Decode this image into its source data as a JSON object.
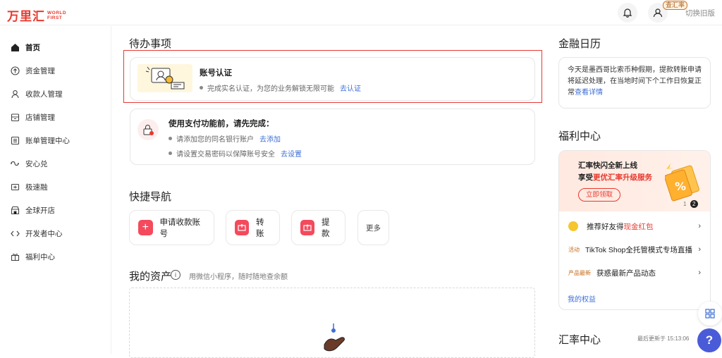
{
  "header": {
    "logo_cn": "万里汇",
    "logo_en_1": "WORLD",
    "logo_en_2": "FIRST",
    "rate_badge": "查汇率",
    "switch_old": "切换旧版"
  },
  "sidebar": {
    "items": [
      {
        "label": "首页",
        "icon": "home-icon",
        "active": true
      },
      {
        "label": "资金管理",
        "icon": "funds-icon"
      },
      {
        "label": "收款人管理",
        "icon": "payee-icon"
      },
      {
        "label": "店铺管理",
        "icon": "store-icon"
      },
      {
        "label": "账单管理中心",
        "icon": "bill-icon"
      },
      {
        "label": "安心兑",
        "icon": "exchange-icon"
      },
      {
        "label": "极速融",
        "icon": "finance-icon"
      },
      {
        "label": "全球开店",
        "icon": "global-store-icon"
      },
      {
        "label": "开发者中心",
        "icon": "developer-icon"
      },
      {
        "label": "福利中心",
        "icon": "gift-icon"
      }
    ]
  },
  "todo": {
    "title": "待办事项",
    "account_verify": {
      "title": "账号认证",
      "desc": "完成实名认证，为您的业务解锁无限可能",
      "link": "去认证"
    },
    "payment_setup": {
      "title": "使用支付功能前，请先完成：",
      "items": [
        {
          "text": "请添加您的同名银行账户",
          "link": "去添加"
        },
        {
          "text": "请设置交易密码以保障账号安全",
          "link": "去设置"
        }
      ]
    }
  },
  "quick_nav": {
    "title": "快捷导航",
    "items": [
      {
        "label": "申请收款账号"
      },
      {
        "label": "转账"
      },
      {
        "label": "提款"
      },
      {
        "label": "更多"
      }
    ]
  },
  "assets": {
    "title": "我的资产",
    "hint": "用微信小程序，随时随地查余额"
  },
  "calendar": {
    "title": "金融日历",
    "text": "今天是墨西哥比索币种假期，提款转账申请将延迟处理，在当地时间下个工作日恢复正常",
    "link": "查看详情"
  },
  "welfare": {
    "title": "福利中心",
    "banner_line1": "汇率快闪全新上线",
    "banner_line2_prefix": "享受",
    "banner_line2_highlight": "更优汇率升级服务",
    "banner_button": "立即领取",
    "banner_page": "1",
    "banner_page_active": "2",
    "rows": [
      {
        "tag": "",
        "text": "推荐好友得",
        "highlight": "现金红包"
      },
      {
        "tag": "活动",
        "text": "TikTok Shop全托管模式专场直播",
        "highlight": ""
      },
      {
        "tag": "产品最新",
        "text": "获惑最新产品动态",
        "highlight": ""
      }
    ],
    "my_benefits": "我的权益"
  },
  "fx": {
    "title": "汇率中心",
    "updated": "最后更新于 15:13:06"
  },
  "colors": {
    "brand": "#e8392f",
    "link": "#3d6fd6",
    "quick_icon": "#f44a5c",
    "help": "#4a5bd8"
  }
}
